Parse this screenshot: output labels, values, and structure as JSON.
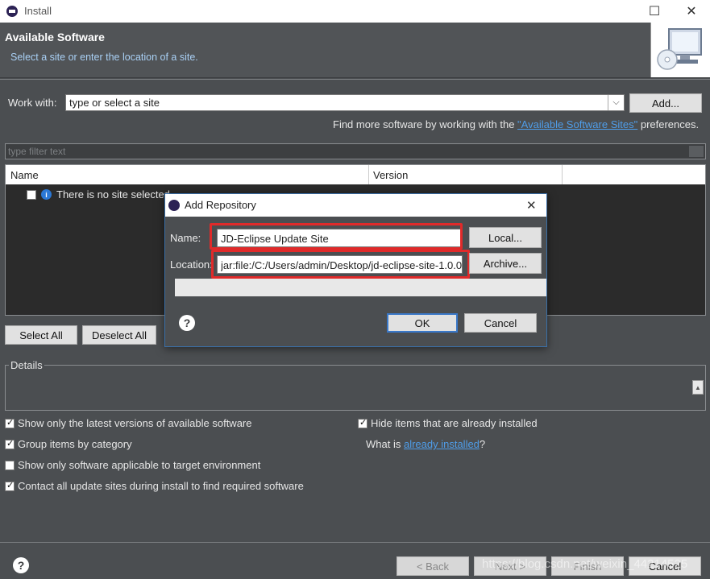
{
  "window": {
    "title": "Install",
    "minimize": "☐",
    "close": "✕"
  },
  "header": {
    "title": "Available Software",
    "subtitle": "Select a site or enter the location of a site."
  },
  "work_with": {
    "label": "Work with:",
    "value": "type or select a site",
    "add_button": "Add...",
    "find_more_prefix": "Find more software by working with the ",
    "find_more_link": "\"Available Software Sites\"",
    "find_more_suffix": " preferences."
  },
  "filter": {
    "placeholder": "type filter text"
  },
  "table": {
    "columns": [
      "Name",
      "Version"
    ],
    "empty_row": "There is no site selected."
  },
  "selection": {
    "select_all": "Select All",
    "deselect_all": "Deselect All"
  },
  "details": {
    "label": "Details"
  },
  "options": {
    "latest_versions": "Show only the latest versions of available software",
    "group_by_category": "Group items by category",
    "target_env": "Show only software applicable to target environment",
    "contact_sites": "Contact all update sites during install to find required software",
    "hide_installed": "Hide items that are already installed",
    "what_is_prefix": "What is ",
    "what_is_link": "already installed",
    "what_is_suffix": "?"
  },
  "footer": {
    "back": "< Back",
    "next": "Next >",
    "finish": "Finish",
    "cancel": "Cancel",
    "watermark": "https://blog.csdn.net/weixin_44214525"
  },
  "dialog": {
    "title": "Add Repository",
    "close": "✕",
    "name_label": "Name:",
    "name_value": "JD-Eclipse Update Site",
    "local_button": "Local...",
    "location_label": "Location:",
    "location_value": "jar:file:/C:/Users/admin/Desktop/jd-eclipse-site-1.0.0",
    "archive_button": "Archive...",
    "ok": "OK",
    "cancel": "Cancel"
  },
  "colors": {
    "background": "#4b4e51",
    "link": "#4f9de9",
    "highlight": "#e02a2a"
  }
}
